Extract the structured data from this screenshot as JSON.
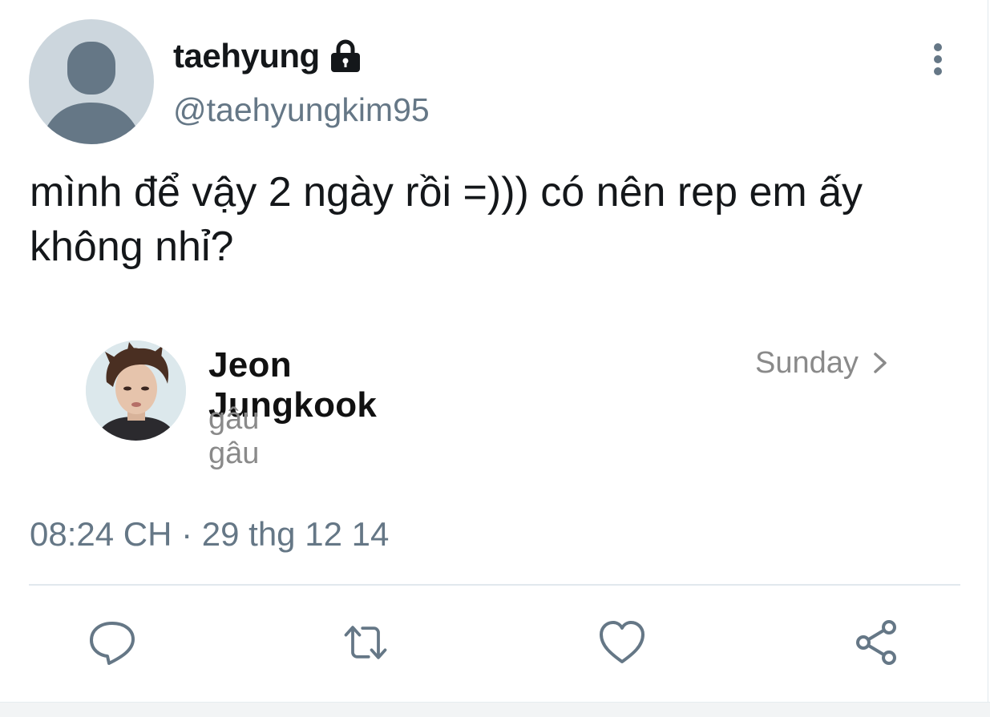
{
  "tweet": {
    "author": {
      "display_name": "taehyung",
      "handle": "@taehyungkim95",
      "protected_icon": "lock-icon",
      "avatar_icon": "default-avatar-icon"
    },
    "text": "mình để vậy 2 ngày rồi =))) có nên rep em ấy không nhỉ?",
    "embedded_chat": {
      "contact_name": "Jeon Jungkook",
      "last_message": "gâu gâu",
      "time": "Sunday",
      "chevron_icon": "chevron-right-icon",
      "avatar_icon": "contact-photo"
    },
    "timestamp": {
      "time": "08:24 CH",
      "separator": " · ",
      "date": "29 thg 12 14"
    },
    "actions": [
      {
        "name": "reply",
        "icon": "reply-icon"
      },
      {
        "name": "retweet",
        "icon": "retweet-icon"
      },
      {
        "name": "like",
        "icon": "heart-icon"
      },
      {
        "name": "share",
        "icon": "share-icon"
      }
    ],
    "more_icon": "more-vertical-icon"
  },
  "colors": {
    "primary_text": "#14171a",
    "secondary_text": "#657786",
    "icon": "#657786",
    "divider": "#e1e8ed",
    "avatar_bg": "#ccd6dd",
    "avatar_fg": "#657786",
    "chat_secondary": "#8a8a8a"
  }
}
